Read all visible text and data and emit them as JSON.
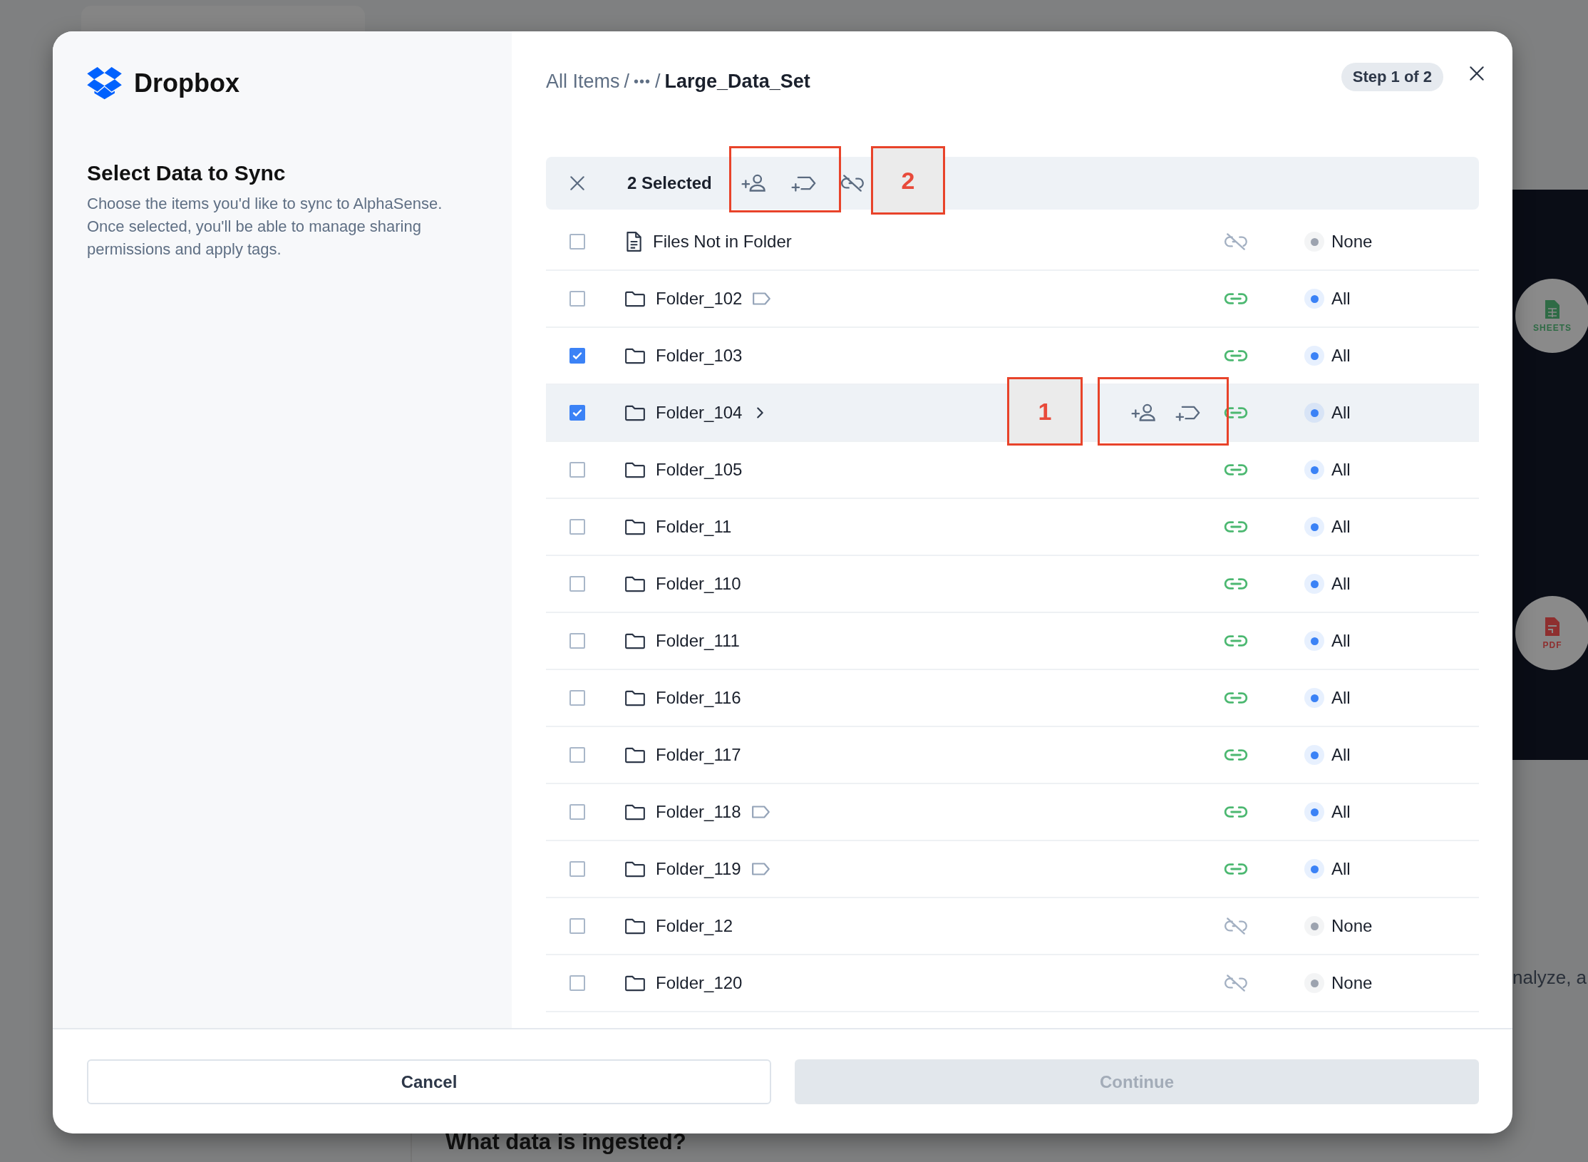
{
  "background": {
    "side_text": "nalyze, a",
    "subheading": "What data is ingested?",
    "badges": [
      {
        "label": "SHEETS",
        "kind": "sheets"
      },
      {
        "label": "PDF",
        "kind": "pdf"
      }
    ]
  },
  "sidebar": {
    "brand": "Dropbox",
    "title": "Select Data to Sync",
    "description": "Choose the items you'd like to sync to AlphaSense. Once selected, you'll be able to manage sharing permissions and apply tags."
  },
  "breadcrumb": [
    {
      "label": "All Items",
      "kind": "link"
    },
    {
      "label": "/",
      "kind": "separator"
    },
    {
      "label": "•••",
      "kind": "ellipsis"
    },
    {
      "label": "/",
      "kind": "separator"
    },
    {
      "label": "Large_Data_Set",
      "kind": "current"
    }
  ],
  "step": "Step 1 of 2",
  "selection_bar": {
    "count": "2 Selected"
  },
  "rows": [
    {
      "name": "Files Not in Folder",
      "kind": "file",
      "checked": false,
      "tagged": false,
      "linked": false,
      "hovered": false,
      "access": "None",
      "color": "#9ca3af"
    },
    {
      "name": "Folder_102",
      "kind": "folder",
      "checked": false,
      "tagged": true,
      "linked": true,
      "hovered": false,
      "access": "All",
      "color": "#3b82f6"
    },
    {
      "name": "Folder_103",
      "kind": "folder",
      "checked": true,
      "tagged": false,
      "linked": true,
      "hovered": false,
      "access": "All",
      "color": "#3b82f6"
    },
    {
      "name": "Folder_104",
      "kind": "folder",
      "checked": true,
      "tagged": false,
      "linked": true,
      "hovered": true,
      "access": "All",
      "color": "#3b82f6"
    },
    {
      "name": "Folder_105",
      "kind": "folder",
      "checked": false,
      "tagged": false,
      "linked": true,
      "hovered": false,
      "access": "All",
      "color": "#3b82f6"
    },
    {
      "name": "Folder_11",
      "kind": "folder",
      "checked": false,
      "tagged": false,
      "linked": true,
      "hovered": false,
      "access": "All",
      "color": "#3b82f6"
    },
    {
      "name": "Folder_110",
      "kind": "folder",
      "checked": false,
      "tagged": false,
      "linked": true,
      "hovered": false,
      "access": "All",
      "color": "#3b82f6"
    },
    {
      "name": "Folder_111",
      "kind": "folder",
      "checked": false,
      "tagged": false,
      "linked": true,
      "hovered": false,
      "access": "All",
      "color": "#3b82f6"
    },
    {
      "name": "Folder_116",
      "kind": "folder",
      "checked": false,
      "tagged": false,
      "linked": true,
      "hovered": false,
      "access": "All",
      "color": "#3b82f6"
    },
    {
      "name": "Folder_117",
      "kind": "folder",
      "checked": false,
      "tagged": false,
      "linked": true,
      "hovered": false,
      "access": "All",
      "color": "#3b82f6"
    },
    {
      "name": "Folder_118",
      "kind": "folder",
      "checked": false,
      "tagged": true,
      "linked": true,
      "hovered": false,
      "access": "All",
      "color": "#3b82f6"
    },
    {
      "name": "Folder_119",
      "kind": "folder",
      "checked": false,
      "tagged": true,
      "linked": true,
      "hovered": false,
      "access": "All",
      "color": "#3b82f6"
    },
    {
      "name": "Folder_12",
      "kind": "folder",
      "checked": false,
      "tagged": false,
      "linked": false,
      "hovered": false,
      "access": "None",
      "color": "#9ca3af"
    },
    {
      "name": "Folder_120",
      "kind": "folder",
      "checked": false,
      "tagged": false,
      "linked": false,
      "hovered": false,
      "access": "None",
      "color": "#9ca3af"
    }
  ],
  "buttons": [
    {
      "label": "Cancel",
      "kind": "secondary"
    },
    {
      "label": "Continue",
      "kind": "primary",
      "disabled": true
    }
  ],
  "annotations": [
    {
      "kind": "frame"
    },
    {
      "kind": "box",
      "label": "2"
    },
    {
      "kind": "box",
      "label": "1"
    },
    {
      "kind": "frame"
    }
  ]
}
